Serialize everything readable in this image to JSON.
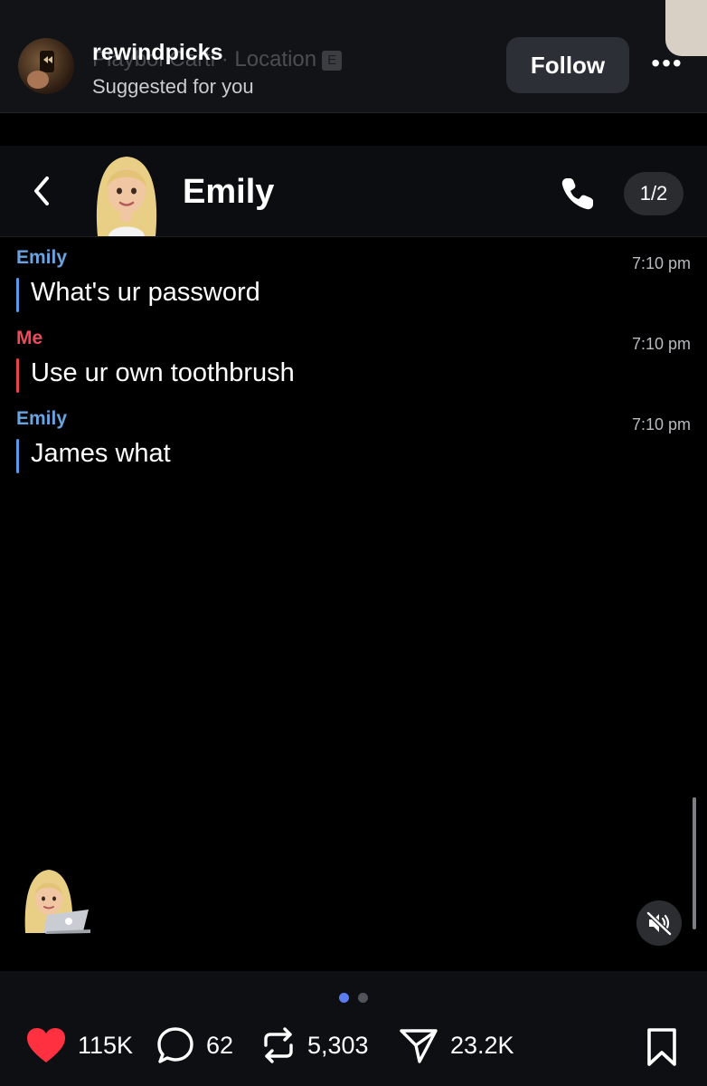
{
  "post": {
    "author": "rewindpicks",
    "ghost_subtitle": "Playboi Carti · Location",
    "ghost_badge": "E",
    "subtitle": "Suggested for you",
    "follow_label": "Follow",
    "more_label": "•••"
  },
  "chat": {
    "contact_name": "Emily",
    "page_indicator": "1/2",
    "messages": [
      {
        "sender": "Emily",
        "time": "7:10 pm",
        "text": "What's ur password"
      },
      {
        "sender": "Me",
        "time": "7:10 pm",
        "text": "Use ur own toothbrush"
      },
      {
        "sender": "Emily",
        "time": "7:10 pm",
        "text": "James what"
      }
    ]
  },
  "footer": {
    "likes": "115K",
    "comments": "62",
    "reposts": "5,303",
    "shares": "23.2K",
    "carousel": {
      "pages": 2,
      "active": 1
    }
  },
  "colors": {
    "emily": "#69a3e0",
    "me": "#ee4a5b",
    "like": "#ff3040",
    "carousel_active": "#5b7cf0"
  },
  "icons": [
    "back-chevron-icon",
    "phone-icon",
    "video-camera-icon",
    "muted-speaker-icon",
    "heart-icon",
    "comment-icon",
    "repost-icon",
    "share-icon",
    "bookmark-icon"
  ]
}
